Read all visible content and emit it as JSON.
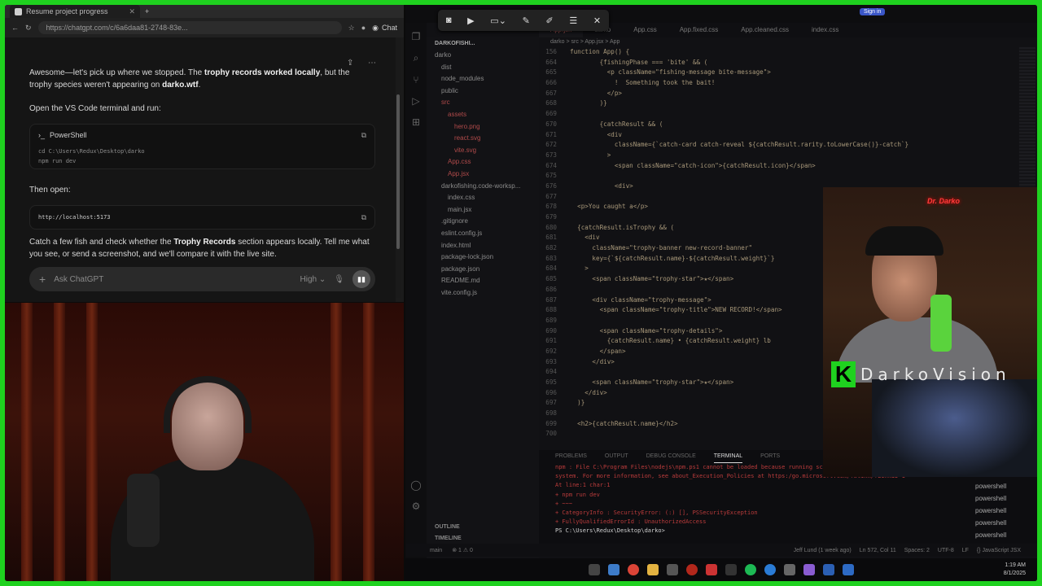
{
  "browser": {
    "tab_title": "Resume project progress",
    "url": "https://chatgpt.com/c/6a6daa81-2748-83e...",
    "chat_button": "Chat"
  },
  "chat": {
    "para1_a": "Awesome—let's pick up where we stopped. The ",
    "para1_b": "trophy records worked locally",
    "para1_c": ", but the trophy species weren't appearing on ",
    "para1_d": "darko.wtf",
    "para1_e": ".",
    "para2": "Open the VS Code terminal and run:",
    "code1_lang": "PowerShell",
    "code1_line1": "cd C:\\Users\\Redux\\Desktop\\darko",
    "code1_line2": "npm run dev",
    "para3": "Then open:",
    "code2_line": "http://localhost:5173",
    "para4_a": "Catch a few fish and check whether the ",
    "para4_b": "Trophy Records",
    "para4_c": " section appears locally. Tell me what you see, or send a screenshot, and we'll compare it with the live site.",
    "input_placeholder": "Ask ChatGPT",
    "model_label": "High"
  },
  "vscode": {
    "tabs": [
      "App.jsx",
      "darko",
      "App.css",
      "App.fixed.css",
      "App.cleaned.css",
      "index.css"
    ],
    "breadcrumb": "darko > src > App.jsx > App",
    "explorer_header": "DARKOFISHI...",
    "tree": [
      "darko",
      "dist",
      "node_modules",
      "public",
      "src",
      "assets",
      "hero.png",
      "react.svg",
      "vite.svg",
      "App.css",
      "App.jsx",
      "darkofishing.code-worksp...",
      "index.css",
      "main.jsx",
      ".gitignore",
      "eslint.config.js",
      "index.html",
      "package-lock.json",
      "package.json",
      "README.md",
      "vite.config.js"
    ],
    "outline": "OUTLINE",
    "timeline": "TIMELINE",
    "code_lines": [
      {
        "n": "156",
        "t": "function App() {"
      },
      {
        "n": "664",
        "t": "        {fishingPhase === 'bite' && ("
      },
      {
        "n": "665",
        "t": "          <p className=\"fishing-message bite-message\">"
      },
      {
        "n": "666",
        "t": "            !  Something took the bait!"
      },
      {
        "n": "667",
        "t": "          </p>"
      },
      {
        "n": "668",
        "t": "        )}"
      },
      {
        "n": "669",
        "t": ""
      },
      {
        "n": "670",
        "t": "        {catchResult && ("
      },
      {
        "n": "671",
        "t": "          <div"
      },
      {
        "n": "672",
        "t": "            className={`catch-card catch-reveal ${catchResult.rarity.toLowerCase()}-catch`}"
      },
      {
        "n": "673",
        "t": "          >"
      },
      {
        "n": "674",
        "t": "            <span className=\"catch-icon\">{catchResult.icon}</span>"
      },
      {
        "n": "675",
        "t": ""
      },
      {
        "n": "676",
        "t": "            <div>"
      },
      {
        "n": "677",
        "t": ""
      },
      {
        "n": "678",
        "t": "  <p>You caught a</p>"
      },
      {
        "n": "679",
        "t": ""
      },
      {
        "n": "680",
        "t": "  {catchResult.isTrophy && ("
      },
      {
        "n": "681",
        "t": "    <div"
      },
      {
        "n": "682",
        "t": "      className=\"trophy-banner new-record-banner\""
      },
      {
        "n": "683",
        "t": "      key={`${catchResult.name}-${catchResult.weight}`}"
      },
      {
        "n": "684",
        "t": "    >"
      },
      {
        "n": "685",
        "t": "      <span className=\"trophy-star\">★</span>"
      },
      {
        "n": "686",
        "t": ""
      },
      {
        "n": "687",
        "t": "      <div className=\"trophy-message\">"
      },
      {
        "n": "688",
        "t": "        <span className=\"trophy-title\">NEW RECORD!</span>"
      },
      {
        "n": "689",
        "t": ""
      },
      {
        "n": "690",
        "t": "        <span className=\"trophy-details\">"
      },
      {
        "n": "691",
        "t": "          {catchResult.name} • {catchResult.weight} lb"
      },
      {
        "n": "692",
        "t": "        </span>"
      },
      {
        "n": "693",
        "t": "      </div>"
      },
      {
        "n": "694",
        "t": ""
      },
      {
        "n": "695",
        "t": "      <span className=\"trophy-star\">★</span>"
      },
      {
        "n": "696",
        "t": "    </div>"
      },
      {
        "n": "697",
        "t": "  )}"
      },
      {
        "n": "698",
        "t": ""
      },
      {
        "n": "699",
        "t": "  <h2>{catchResult.name}</h2>"
      },
      {
        "n": "700",
        "t": ""
      }
    ],
    "panel_tabs": [
      "PROBLEMS",
      "OUTPUT",
      "DEBUG CONSOLE",
      "TERMINAL",
      "PORTS"
    ],
    "terminal": [
      {
        "c": "e",
        "t": "npm : File C:\\Program Files\\nodejs\\npm.ps1 cannot be loaded because running scripts"
      },
      {
        "c": "e",
        "t": "system. For more information, see about_Execution_Policies at https:/go.microsoft.com/fwlink/?LinkID=1"
      },
      {
        "c": "e",
        "t": "At line:1 char:1"
      },
      {
        "c": "e",
        "t": "+ npm run dev"
      },
      {
        "c": "e",
        "t": "+ ~~~"
      },
      {
        "c": "e",
        "t": "    + CategoryInfo          : SecurityError: (:) [], PSSecurityException"
      },
      {
        "c": "e",
        "t": "    + FullyQualifiedErrorId : UnauthorizedAccess"
      },
      {
        "c": "p",
        "t": "PS C:\\Users\\Redux\\Desktop\\darko> "
      }
    ],
    "shells": [
      "powershell",
      "powershell",
      "powershell",
      "powershell",
      "powershell"
    ],
    "status_left": [
      "main",
      "⊗ 1 ⚠ 0"
    ],
    "status_right": [
      "Jeff Lund (1 week ago)",
      "Ln 572, Col 11",
      "Spaces: 2",
      "UTF-8",
      "LF",
      "{} JavaScript JSX"
    ],
    "signin": "Sign in",
    "clock_time": "1:19 AM",
    "clock_date": "8/1/2025"
  },
  "overlay": {
    "neon_sign": "Dr. Darko",
    "brand_word": "DarkoVision",
    "brand_letter": "K"
  },
  "colors": {
    "border_green": "#1fd11f",
    "error_red": "#b93b3b",
    "tab_active": "#d46d6d"
  }
}
